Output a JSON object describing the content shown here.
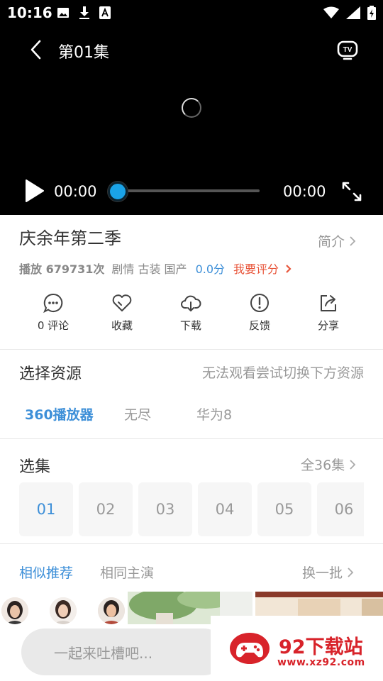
{
  "status_bar": {
    "time": "10:16"
  },
  "player": {
    "episode_title": "第01集",
    "current_time": "00:00",
    "total_time": "00:00",
    "progress": 0
  },
  "show": {
    "title": "庆余年第二季",
    "intro_label": "简介",
    "plays": "播放 679731次",
    "genres": "剧情 古装 国产",
    "score": "0.0分",
    "rate_label": "我要评分"
  },
  "actions": [
    {
      "icon": "comment-icon",
      "label": "0 评论"
    },
    {
      "icon": "heart-icon",
      "label": "收藏"
    },
    {
      "icon": "cloud-download-icon",
      "label": "下载"
    },
    {
      "icon": "alert-icon",
      "label": "反馈"
    },
    {
      "icon": "share-icon",
      "label": "分享"
    }
  ],
  "source": {
    "title": "选择资源",
    "hint": "无法观看尝试切换下方资源",
    "tabs": [
      "360播放器",
      "无尽",
      "华为8"
    ],
    "selected": "360播放器"
  },
  "episodes": {
    "title": "选集",
    "all_label": "全36集",
    "items": [
      "01",
      "02",
      "03",
      "04",
      "05",
      "06"
    ],
    "selected": "01"
  },
  "recommend": {
    "tabs": [
      "相似推荐",
      "相同主演"
    ],
    "selected": "相似推荐",
    "refresh_label": "换一批"
  },
  "comment": {
    "placeholder": "一起来吐槽吧..."
  },
  "watermark": {
    "name": "92下载站",
    "url": "www.xz92.com"
  },
  "colors": {
    "accent": "#3d8fd8",
    "rate": "#e8553a",
    "seek": "#1aa3e8",
    "watermark": "#d8232a"
  }
}
